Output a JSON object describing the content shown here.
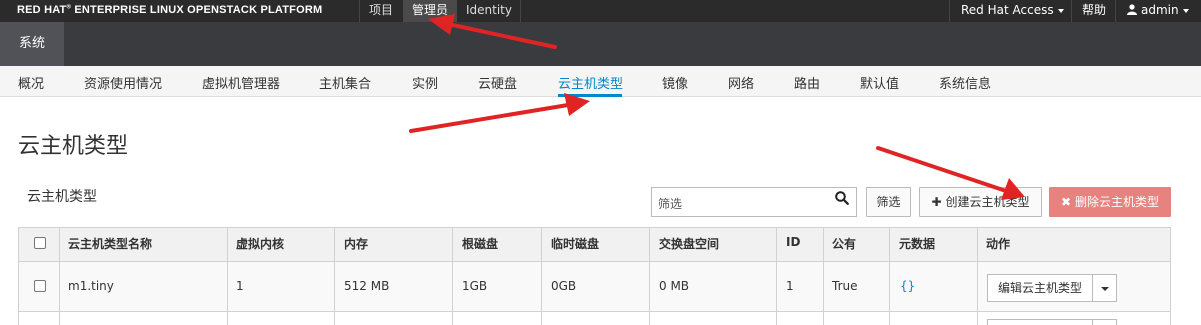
{
  "topbar": {
    "brand": "RED HAT",
    "brand_mark": "®",
    "brand_rest": " ENTERPRISE LINUX OPENSTACK PLATFORM",
    "nav": [
      "项目",
      "管理员",
      "Identity"
    ],
    "right": {
      "access_label": "Red Hat Access",
      "help_label": "帮助",
      "user_label": "admin"
    }
  },
  "secondbar": {
    "active_label": "系统"
  },
  "subnav": {
    "items": [
      "概况",
      "资源使用情况",
      "虚拟机管理器",
      "主机集合",
      "实例",
      "云硬盘",
      "云主机类型",
      "镜像",
      "网络",
      "路由",
      "默认值",
      "系统信息"
    ],
    "active_index": 6
  },
  "page": {
    "title": "云主机类型"
  },
  "panel": {
    "title": "云主机类型",
    "filter_placeholder": "筛选",
    "filter_button": "筛选",
    "create_button": "创建云主机类型",
    "create_icon": "plus-icon",
    "delete_button": "删除云主机类型",
    "delete_icon": "times-icon"
  },
  "table": {
    "columns": [
      "云主机类型名称",
      "虚拟内核",
      "内存",
      "根磁盘",
      "临时磁盘",
      "交换盘空间",
      "ID",
      "公有",
      "元数据",
      "动作"
    ],
    "rows": [
      {
        "name": "m1.tiny",
        "vcpus": "1",
        "ram": "512 MB",
        "root_disk": "1GB",
        "ephemeral": "0GB",
        "swap": "0 MB",
        "id": "1",
        "public": "True",
        "metadata": "{}",
        "action": "编辑云主机类型"
      }
    ]
  },
  "colors": {
    "accent": "#0088ce",
    "topbar_bg": "#2b2b2b",
    "secondbar_bg": "#393b3f",
    "delete_button_bg": "#e6837f",
    "annotation_arrow": "#e02424"
  }
}
